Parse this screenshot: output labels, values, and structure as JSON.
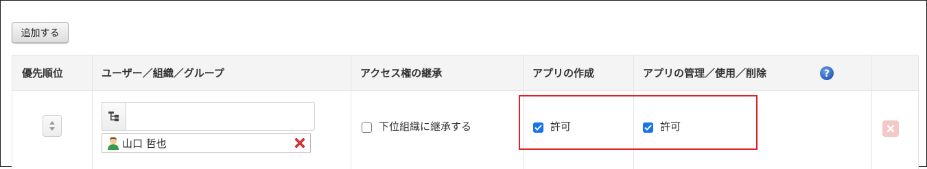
{
  "toolbar": {
    "add_label": "追加する"
  },
  "table": {
    "headers": {
      "priority": "優先順位",
      "entity": "ユーザー／組織／グループ",
      "inherit": "アクセス権の継承",
      "create": "アプリの作成",
      "manage": "アプリの管理／使用／削除"
    },
    "rows": [
      {
        "entity_input_value": "",
        "selected_user": "山口 哲也",
        "inherit_label": "下位組織に継承する",
        "inherit_checked": false,
        "create_label": "許可",
        "create_checked": true,
        "manage_label": "許可",
        "manage_checked": true
      }
    ]
  },
  "icons": {
    "help": "question-circle-icon",
    "tree": "org-tree-icon",
    "user": "user-avatar-icon",
    "remove": "red-x-icon",
    "delete_row": "delete-row-icon",
    "sort": "up-down-arrows-icon"
  },
  "colors": {
    "highlight": "#e21f26",
    "checkbox": "#1a73e8",
    "help": "#2d6ac6",
    "remove": "#e0383a"
  }
}
